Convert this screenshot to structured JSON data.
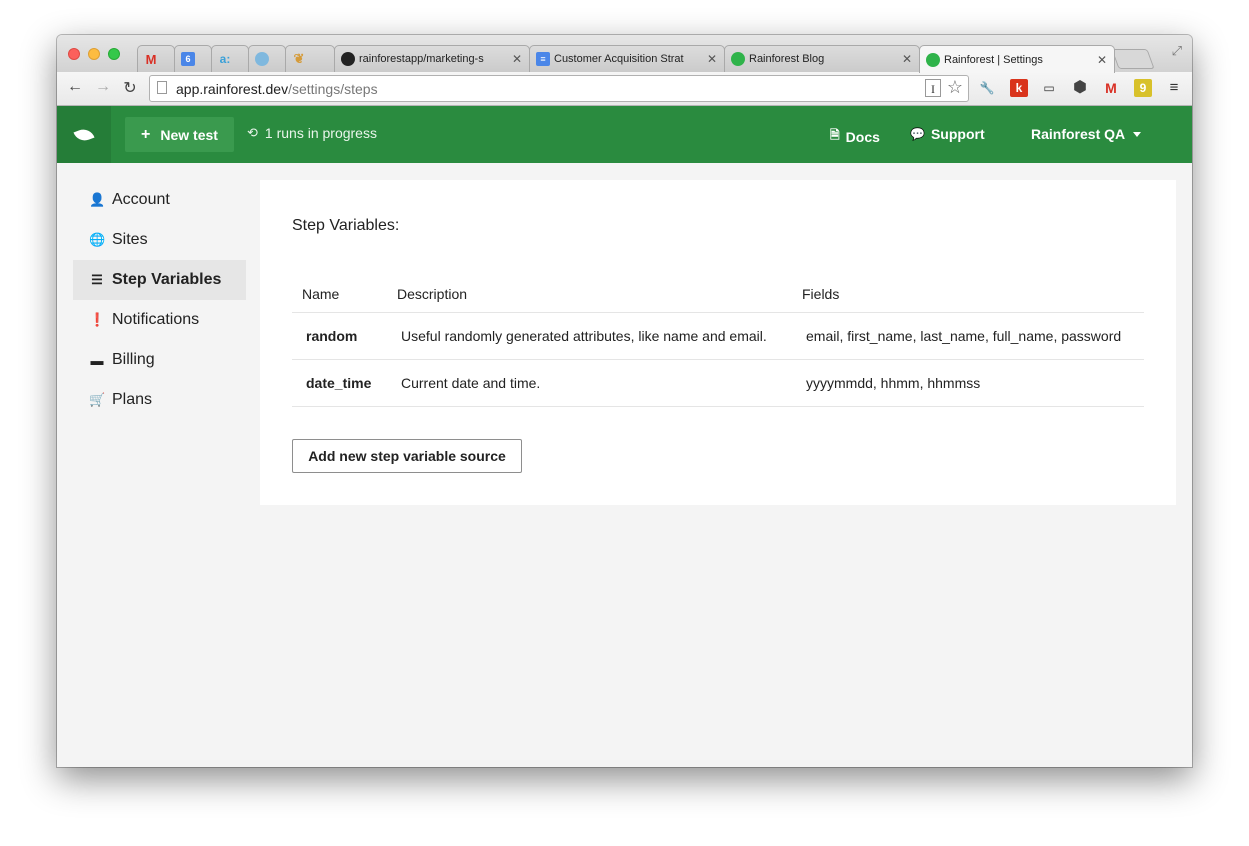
{
  "browser": {
    "tabs": [
      {
        "label": "",
        "icon": "gmail-icon",
        "color": "#d93025"
      },
      {
        "label": "",
        "icon": "calendar-icon",
        "color": "#4a86e8"
      },
      {
        "label": "",
        "icon": "ai-icon",
        "color": "#3aa0d8"
      },
      {
        "label": "",
        "icon": "db-icon",
        "color": "#3f8fbf"
      },
      {
        "label": "",
        "icon": "feather-icon",
        "color": "#d59b3a"
      },
      {
        "label": "rainforestapp/marketing-s",
        "icon": "github-icon",
        "color": "#222222"
      },
      {
        "label": "Customer Acquisition Strat",
        "icon": "docs-icon",
        "color": "#4a86e8"
      },
      {
        "label": "Rainforest Blog",
        "icon": "rainforest-icon",
        "color": "#2fb34a"
      },
      {
        "label": "Rainforest | Settings",
        "icon": "rainforest-icon",
        "color": "#2fb34a"
      }
    ],
    "url_host": "app.rainforest.dev",
    "url_path": "/settings/steps",
    "extensions": [
      "wrench-icon",
      "k-extension-icon",
      "cast-icon",
      "hex-extension-icon",
      "gmail-extension-icon",
      "9-extension-icon",
      "menu-icon"
    ],
    "ext_k": "k",
    "ext_9": "9"
  },
  "header": {
    "new_test": "New test",
    "runs": "1 runs in progress",
    "docs": "Docs",
    "support": "Support",
    "account": "Rainforest QA",
    "brand_color": "#2a8b3f"
  },
  "sidebar": {
    "items": [
      {
        "label": "Account",
        "icon": "user-icon",
        "active": false
      },
      {
        "label": "Sites",
        "icon": "globe-icon",
        "active": false
      },
      {
        "label": "Step Variables",
        "icon": "list-icon",
        "active": true
      },
      {
        "label": "Notifications",
        "icon": "alert-icon",
        "active": false
      },
      {
        "label": "Billing",
        "icon": "credit-card-icon",
        "active": false
      },
      {
        "label": "Plans",
        "icon": "cart-icon",
        "active": false
      }
    ]
  },
  "main": {
    "title": "Step Variables:",
    "columns": [
      "Name",
      "Description",
      "Fields"
    ],
    "rows": [
      {
        "name": "random",
        "description": "Useful randomly generated attributes, like name and email.",
        "fields": "email, first_name, last_name, full_name, password"
      },
      {
        "name": "date_time",
        "description": "Current date and time.",
        "fields": "yyyymmdd, hhmm, hhmmss"
      }
    ],
    "add_button": "Add new step variable source"
  }
}
